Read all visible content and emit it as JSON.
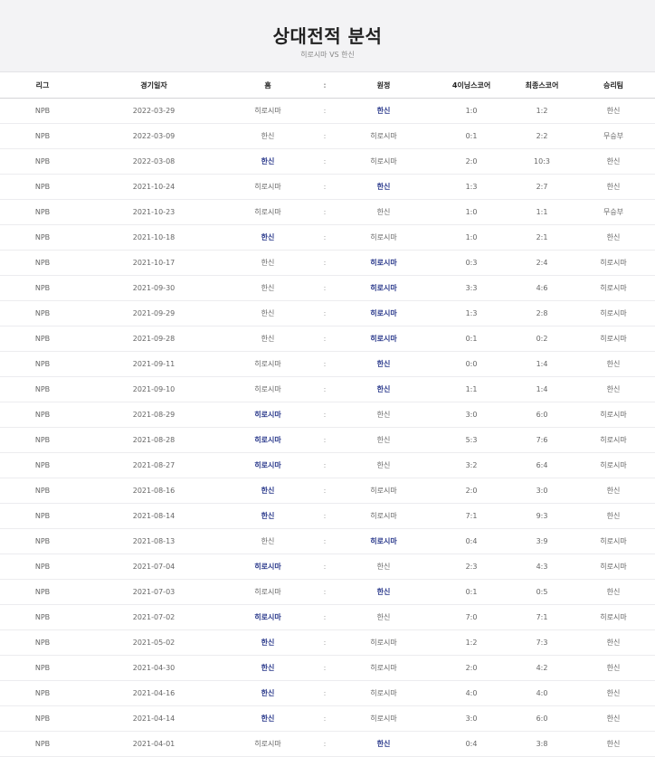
{
  "header": {
    "title": "상대전적 분석",
    "subtitle": "히로시마 VS 한신"
  },
  "columns": [
    "리그",
    "경기일자",
    "홈",
    ":",
    "원정",
    "4이닝스코어",
    "최종스코어",
    "승리팀"
  ],
  "rows": [
    {
      "league": "NPB",
      "date": "2022-03-29",
      "home": "히로시마",
      "sep": ":",
      "away": "한신",
      "score4": "1:0",
      "final": "1:2",
      "winner": "한신",
      "win": "away"
    },
    {
      "league": "NPB",
      "date": "2022-03-09",
      "home": "한신",
      "sep": ":",
      "away": "히로시마",
      "score4": "0:1",
      "final": "2:2",
      "winner": "무승부",
      "win": "none"
    },
    {
      "league": "NPB",
      "date": "2022-03-08",
      "home": "한신",
      "sep": ":",
      "away": "히로시마",
      "score4": "2:0",
      "final": "10:3",
      "winner": "한신",
      "win": "home"
    },
    {
      "league": "NPB",
      "date": "2021-10-24",
      "home": "히로시마",
      "sep": ":",
      "away": "한신",
      "score4": "1:3",
      "final": "2:7",
      "winner": "한신",
      "win": "away"
    },
    {
      "league": "NPB",
      "date": "2021-10-23",
      "home": "히로시마",
      "sep": ":",
      "away": "한신",
      "score4": "1:0",
      "final": "1:1",
      "winner": "무승부",
      "win": "none"
    },
    {
      "league": "NPB",
      "date": "2021-10-18",
      "home": "한신",
      "sep": ":",
      "away": "히로시마",
      "score4": "1:0",
      "final": "2:1",
      "winner": "한신",
      "win": "home"
    },
    {
      "league": "NPB",
      "date": "2021-10-17",
      "home": "한신",
      "sep": ":",
      "away": "히로시마",
      "score4": "0:3",
      "final": "2:4",
      "winner": "히로시마",
      "win": "away"
    },
    {
      "league": "NPB",
      "date": "2021-09-30",
      "home": "한신",
      "sep": ":",
      "away": "히로시마",
      "score4": "3:3",
      "final": "4:6",
      "winner": "히로시마",
      "win": "away"
    },
    {
      "league": "NPB",
      "date": "2021-09-29",
      "home": "한신",
      "sep": ":",
      "away": "히로시마",
      "score4": "1:3",
      "final": "2:8",
      "winner": "히로시마",
      "win": "away"
    },
    {
      "league": "NPB",
      "date": "2021-09-28",
      "home": "한신",
      "sep": ":",
      "away": "히로시마",
      "score4": "0:1",
      "final": "0:2",
      "winner": "히로시마",
      "win": "away"
    },
    {
      "league": "NPB",
      "date": "2021-09-11",
      "home": "히로시마",
      "sep": ":",
      "away": "한신",
      "score4": "0:0",
      "final": "1:4",
      "winner": "한신",
      "win": "away"
    },
    {
      "league": "NPB",
      "date": "2021-09-10",
      "home": "히로시마",
      "sep": ":",
      "away": "한신",
      "score4": "1:1",
      "final": "1:4",
      "winner": "한신",
      "win": "away"
    },
    {
      "league": "NPB",
      "date": "2021-08-29",
      "home": "히로시마",
      "sep": ":",
      "away": "한신",
      "score4": "3:0",
      "final": "6:0",
      "winner": "히로시마",
      "win": "home"
    },
    {
      "league": "NPB",
      "date": "2021-08-28",
      "home": "히로시마",
      "sep": ":",
      "away": "한신",
      "score4": "5:3",
      "final": "7:6",
      "winner": "히로시마",
      "win": "home"
    },
    {
      "league": "NPB",
      "date": "2021-08-27",
      "home": "히로시마",
      "sep": ":",
      "away": "한신",
      "score4": "3:2",
      "final": "6:4",
      "winner": "히로시마",
      "win": "home"
    },
    {
      "league": "NPB",
      "date": "2021-08-16",
      "home": "한신",
      "sep": ":",
      "away": "히로시마",
      "score4": "2:0",
      "final": "3:0",
      "winner": "한신",
      "win": "home"
    },
    {
      "league": "NPB",
      "date": "2021-08-14",
      "home": "한신",
      "sep": ":",
      "away": "히로시마",
      "score4": "7:1",
      "final": "9:3",
      "winner": "한신",
      "win": "home"
    },
    {
      "league": "NPB",
      "date": "2021-08-13",
      "home": "한신",
      "sep": ":",
      "away": "히로시마",
      "score4": "0:4",
      "final": "3:9",
      "winner": "히로시마",
      "win": "away"
    },
    {
      "league": "NPB",
      "date": "2021-07-04",
      "home": "히로시마",
      "sep": ":",
      "away": "한신",
      "score4": "2:3",
      "final": "4:3",
      "winner": "히로시마",
      "win": "home"
    },
    {
      "league": "NPB",
      "date": "2021-07-03",
      "home": "히로시마",
      "sep": ":",
      "away": "한신",
      "score4": "0:1",
      "final": "0:5",
      "winner": "한신",
      "win": "away"
    },
    {
      "league": "NPB",
      "date": "2021-07-02",
      "home": "히로시마",
      "sep": ":",
      "away": "한신",
      "score4": "7:0",
      "final": "7:1",
      "winner": "히로시마",
      "win": "home"
    },
    {
      "league": "NPB",
      "date": "2021-05-02",
      "home": "한신",
      "sep": ":",
      "away": "히로시마",
      "score4": "1:2",
      "final": "7:3",
      "winner": "한신",
      "win": "home"
    },
    {
      "league": "NPB",
      "date": "2021-04-30",
      "home": "한신",
      "sep": ":",
      "away": "히로시마",
      "score4": "2:0",
      "final": "4:2",
      "winner": "한신",
      "win": "home"
    },
    {
      "league": "NPB",
      "date": "2021-04-16",
      "home": "한신",
      "sep": ":",
      "away": "히로시마",
      "score4": "4:0",
      "final": "4:0",
      "winner": "한신",
      "win": "home"
    },
    {
      "league": "NPB",
      "date": "2021-04-14",
      "home": "한신",
      "sep": ":",
      "away": "히로시마",
      "score4": "3:0",
      "final": "6:0",
      "winner": "한신",
      "win": "home"
    },
    {
      "league": "NPB",
      "date": "2021-04-01",
      "home": "히로시마",
      "sep": ":",
      "away": "한신",
      "score4": "0:4",
      "final": "3:8",
      "winner": "한신",
      "win": "away"
    }
  ]
}
